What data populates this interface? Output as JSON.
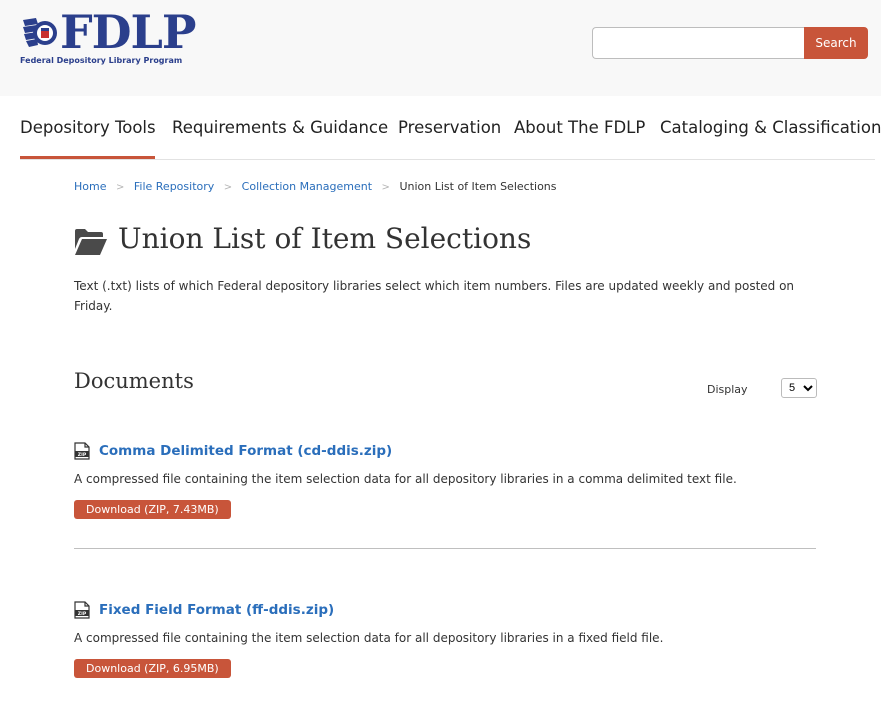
{
  "header": {
    "logo_text": "FDLP",
    "logo_subtitle": "Federal Depository Library Program",
    "search_placeholder": "",
    "search_button": "Search"
  },
  "nav": {
    "items": [
      {
        "label": "Depository Tools"
      },
      {
        "label": "Requirements & Guidance"
      },
      {
        "label": "Preservation"
      },
      {
        "label": "About The FDLP"
      },
      {
        "label": "Cataloging & Classification"
      }
    ]
  },
  "breadcrumb": {
    "items": [
      "Home",
      "File Repository",
      "Collection Management"
    ],
    "current": "Union List of Item Selections"
  },
  "page": {
    "title": "Union List of Item Selections",
    "intro": "Text (.txt) lists of which Federal depository libraries select which item numbers. Files are updated weekly and posted on Friday."
  },
  "documents": {
    "heading": "Documents",
    "display_label": "Display",
    "display_value": "5",
    "items": [
      {
        "title": "Comma Delimited Format (cd-ddis.zip)",
        "description": "A compressed file containing the item selection data for all depository libraries in a comma delimited text file.",
        "button": "Download (ZIP, 7.43MB)"
      },
      {
        "title": "Fixed Field Format (ff-ddis.zip)",
        "description": "A compressed file containing the item selection data for all depository libraries in a fixed field file.",
        "button": "Download (ZIP, 6.95MB)"
      }
    ]
  },
  "colors": {
    "brand_blue": "#2b3f8c",
    "link_blue": "#2a6ebb",
    "accent": "#c8553a"
  }
}
